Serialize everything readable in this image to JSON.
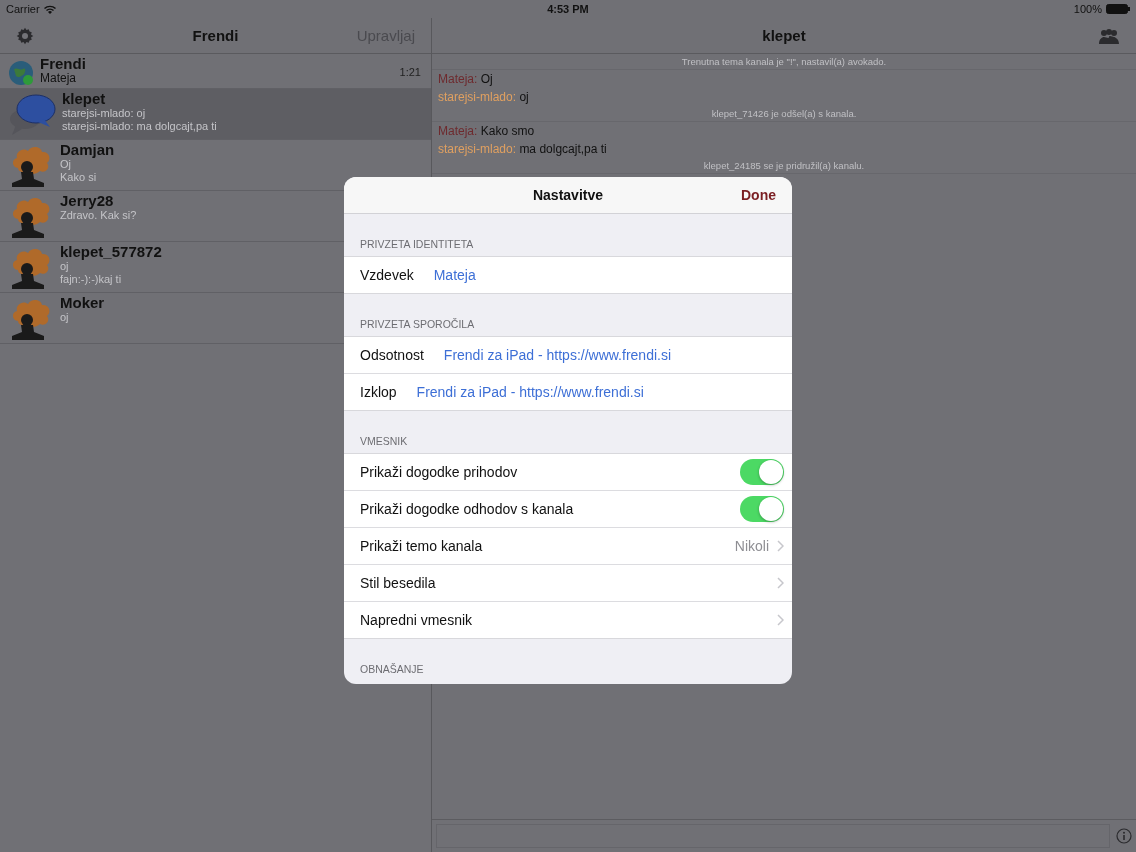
{
  "status_bar": {
    "carrier": "Carrier",
    "time": "4:53 PM",
    "battery": "100%"
  },
  "sidebar": {
    "title": "Frendi",
    "edit_button": "Upravljaj",
    "items": [
      {
        "kind": "server",
        "name": "Frendi",
        "lines": [
          "Mateja"
        ],
        "time": "1:21",
        "selected": false
      },
      {
        "kind": "channel",
        "name": "klepet",
        "lines": [
          "starejsi-mlado: oj",
          "starejsi-mlado: ma dolgcajt,pa ti"
        ],
        "selected": true
      },
      {
        "kind": "user",
        "name": "Damjan",
        "lines": [
          "Oj",
          "Kako si"
        ],
        "selected": false
      },
      {
        "kind": "user",
        "name": "Jerry28",
        "lines": [
          "Zdravo. Kak si?"
        ],
        "selected": false
      },
      {
        "kind": "user",
        "name": "klepet_577872",
        "lines": [
          "oj",
          "fajn:-):-)kaj ti"
        ],
        "selected": false
      },
      {
        "kind": "user",
        "name": "Moker",
        "lines": [
          "oj"
        ],
        "selected": false
      }
    ]
  },
  "chat": {
    "title": "klepet",
    "messages": [
      {
        "kind": "system",
        "text": "Trenutna tema kanala je \"!\", nastavil(a) avokado."
      },
      {
        "kind": "message",
        "sender": "Mateja:",
        "color": "#6e2a2e",
        "text": "Oj"
      },
      {
        "kind": "message",
        "sender": "starejsi-mlado:",
        "color": "#e0a060",
        "text": "oj"
      },
      {
        "kind": "system",
        "text": "klepet_71426 je odšel(a) s kanala."
      },
      {
        "kind": "message",
        "sender": "Mateja:",
        "color": "#6e2a2e",
        "text": "Kako smo"
      },
      {
        "kind": "message",
        "sender": "starejsi-mlado:",
        "color": "#e0a060",
        "text": "ma dolgcajt,pa ti"
      },
      {
        "kind": "system",
        "text": "klepet_24185 se je pridružil(a) kanalu."
      }
    ]
  },
  "settings": {
    "title": "Nastavitve",
    "done": "Done",
    "sections": [
      {
        "header": "PRIVZETA IDENTITETA",
        "rows": [
          {
            "kind": "value",
            "label": "Vzdevek",
            "value": "Mateja"
          }
        ]
      },
      {
        "header": "PRIVZETA SPOROČILA",
        "rows": [
          {
            "kind": "value",
            "label": "Odsotnost",
            "value": "Frendi za iPad - https://www.frendi.si"
          },
          {
            "kind": "value",
            "label": "Izklop",
            "value": "Frendi za iPad - https://www.frendi.si"
          }
        ]
      },
      {
        "header": "VMESNIK",
        "rows": [
          {
            "kind": "toggle",
            "label": "Prikaži dogodke prihodov",
            "on": true
          },
          {
            "kind": "toggle",
            "label": "Prikaži dogodke odhodov s kanala",
            "on": true
          },
          {
            "kind": "disclosure",
            "label": "Prikaži temo kanala",
            "value": "Nikoli"
          },
          {
            "kind": "disclosure",
            "label": "Stil besedila"
          },
          {
            "kind": "disclosure",
            "label": "Napredni vmesnik"
          }
        ]
      },
      {
        "header": "OBNAŠANJE"
      }
    ]
  }
}
